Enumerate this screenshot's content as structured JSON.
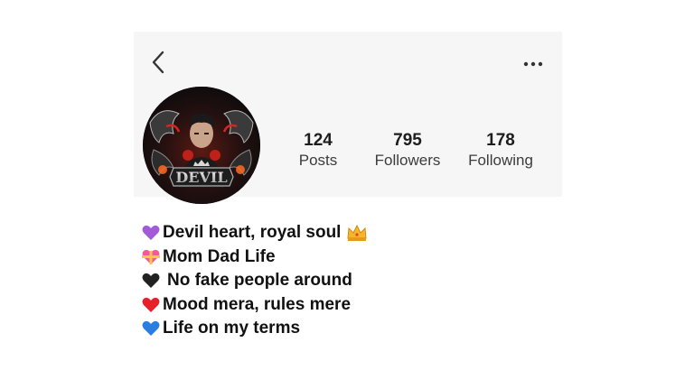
{
  "profile": {
    "stats": [
      {
        "value": "124",
        "label": "Posts"
      },
      {
        "value": "795",
        "label": "Followers"
      },
      {
        "value": "178",
        "label": "Following"
      }
    ],
    "avatar": {
      "logo_text": "DEVIL"
    }
  },
  "bio": {
    "lines": [
      {
        "icon": "purple-heart-icon",
        "text": "Devil heart, royal soul",
        "trailing_icon": "crown-icon"
      },
      {
        "icon": "heart-with-ribbon-icon",
        "text": "Mom Dad Life"
      },
      {
        "icon": "black-heart-icon",
        "text": "No fake people around"
      },
      {
        "icon": "red-heart-icon",
        "text": "Mood mera, rules mere"
      },
      {
        "icon": "blue-heart-icon",
        "text": "Life on my terms"
      }
    ]
  },
  "colors": {
    "card_background": "#f6f6f6",
    "text": "#111111",
    "purple_heart": "#a35ad8",
    "pink_heart": "#f25a9a",
    "black_heart": "#222222",
    "red_heart": "#e8202a",
    "blue_heart": "#2a7de1",
    "crown": "#f6b52a"
  }
}
